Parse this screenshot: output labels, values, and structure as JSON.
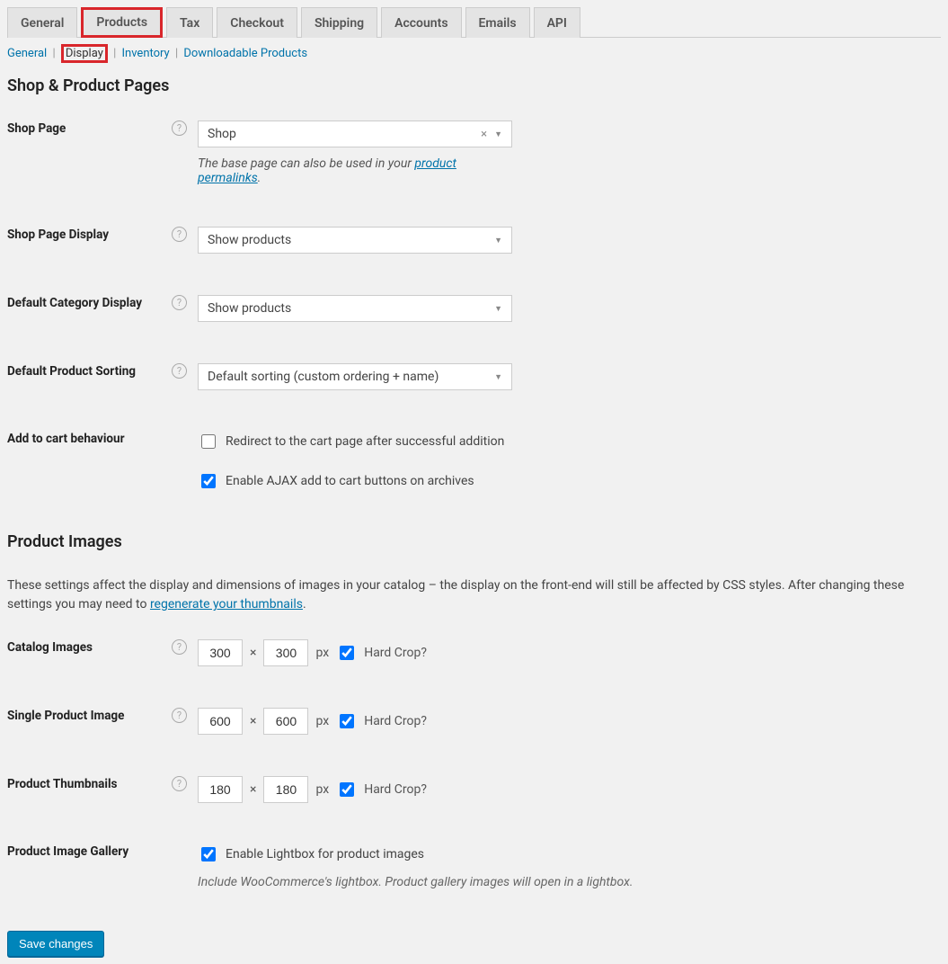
{
  "tabs": {
    "general": "General",
    "products": "Products",
    "tax": "Tax",
    "checkout": "Checkout",
    "shipping": "Shipping",
    "accounts": "Accounts",
    "emails": "Emails",
    "api": "API"
  },
  "subtabs": {
    "general": "General",
    "display": "Display",
    "inventory": "Inventory",
    "downloadable": "Downloadable Products"
  },
  "sections": {
    "shop_pages": "Shop & Product Pages",
    "product_images": "Product Images"
  },
  "labels": {
    "shop_page": "Shop Page",
    "shop_page_display": "Shop Page Display",
    "default_category_display": "Default Category Display",
    "default_product_sorting": "Default Product Sorting",
    "add_to_cart": "Add to cart behaviour",
    "catalog_images": "Catalog Images",
    "single_product_image": "Single Product Image",
    "product_thumbnails": "Product Thumbnails",
    "product_image_gallery": "Product Image Gallery"
  },
  "fields": {
    "shop_page_value": "Shop",
    "shop_page_hint_pre": "The base page can also be used in your ",
    "shop_page_hint_link": "product permalinks",
    "shop_page_display_value": "Show products",
    "default_category_display_value": "Show products",
    "default_product_sorting_value": "Default sorting (custom ordering + name)",
    "redirect_checkbox": "Redirect to the cart page after successful addition",
    "ajax_checkbox": "Enable AJAX add to cart buttons on archives",
    "images_desc_pre": "These settings affect the display and dimensions of images in your catalog – the display on the front-end will still be affected by CSS styles. After changing these settings you may need to ",
    "images_desc_link": "regenerate your thumbnails",
    "px": "px",
    "times": "×",
    "hard_crop": "Hard Crop?",
    "catalog_w": "300",
    "catalog_h": "300",
    "single_w": "600",
    "single_h": "600",
    "thumb_w": "180",
    "thumb_h": "180",
    "lightbox_checkbox": "Enable Lightbox for product images",
    "lightbox_hint": "Include WooCommerce's lightbox. Product gallery images will open in a lightbox."
  },
  "buttons": {
    "save": "Save changes"
  }
}
